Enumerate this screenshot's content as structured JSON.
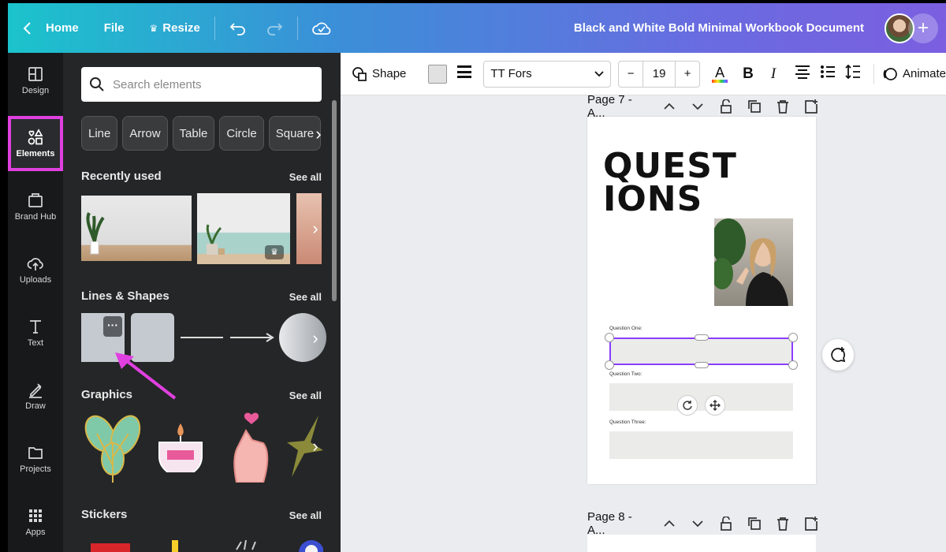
{
  "topbar": {
    "home": "Home",
    "file": "File",
    "resize": "Resize",
    "doc_title": "Black and White Bold Minimal Workbook Document",
    "plus": "+"
  },
  "rail": [
    {
      "label": "Design",
      "icon": "layout-icon"
    },
    {
      "label": "Elements",
      "icon": "shapes-icon",
      "active": true
    },
    {
      "label": "Brand Hub",
      "icon": "brand-hub-icon"
    },
    {
      "label": "Uploads",
      "icon": "cloud-upload-icon"
    },
    {
      "label": "Text",
      "icon": "text-icon"
    },
    {
      "label": "Draw",
      "icon": "pen-icon"
    },
    {
      "label": "Projects",
      "icon": "folder-icon"
    },
    {
      "label": "Apps",
      "icon": "grid-icon"
    }
  ],
  "panel": {
    "search_placeholder": "Search elements",
    "chips": [
      "Line",
      "Arrow",
      "Table",
      "Circle",
      "Square"
    ],
    "recently_used": "Recently used",
    "lines_shapes": "Lines & Shapes",
    "graphics": "Graphics",
    "stickers": "Stickers",
    "see_all": "See all",
    "more_dots": "···"
  },
  "toolbar": {
    "shape": "Shape",
    "font": "TT Fors",
    "font_size": "19",
    "minus": "−",
    "plus": "+",
    "text_color": "A",
    "bold": "B",
    "italic": "I",
    "animate": "Animate"
  },
  "pages": {
    "page7_label": "Page 7 - A...",
    "page8_label": "Page 8 - A..."
  },
  "doc": {
    "heading_line1": "QUEST",
    "heading_line2": "IONS",
    "q1": "Question One:",
    "q2": "Question Two:",
    "q3": "Question Three:"
  },
  "colors": {
    "accent_purple": "#8b3dff",
    "highlight_magenta": "#e040e0"
  }
}
